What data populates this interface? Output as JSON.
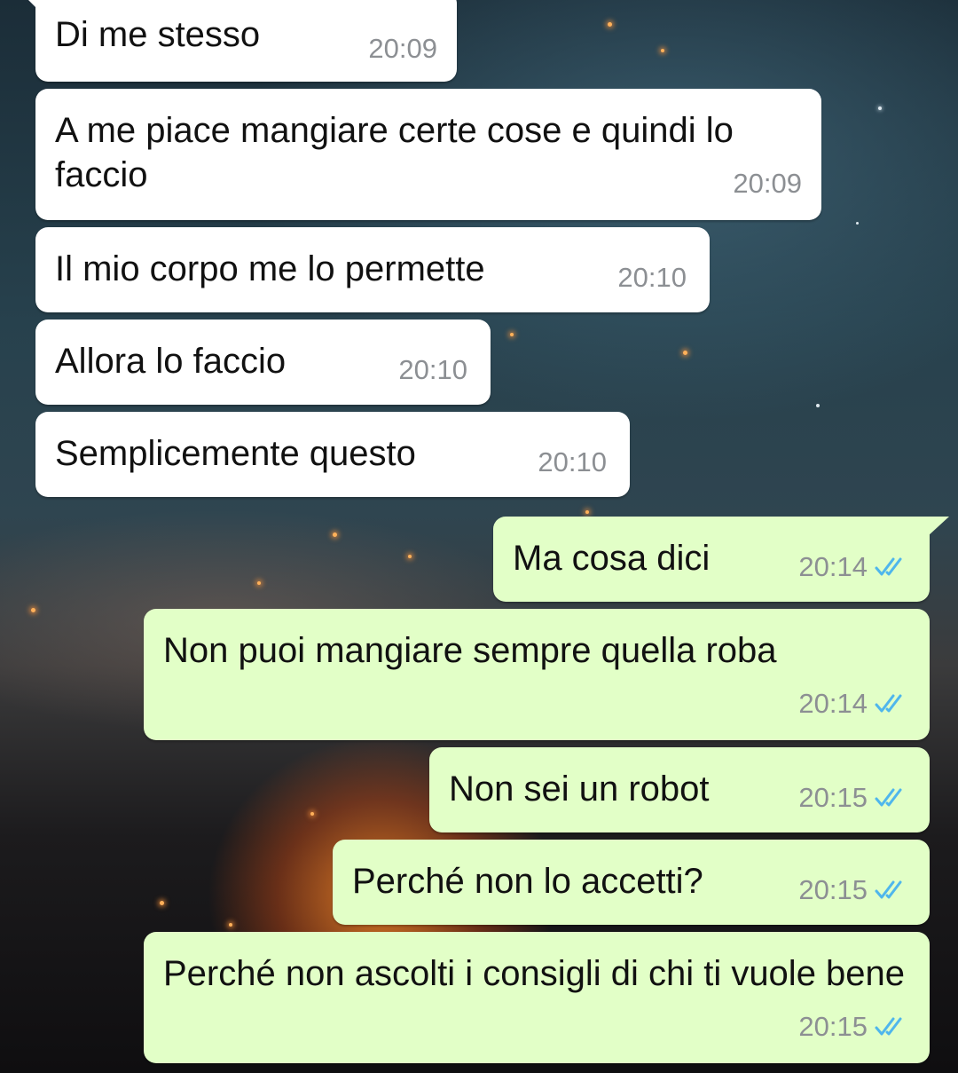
{
  "conversation": {
    "messages": [
      {
        "direction": "incoming",
        "text": "Di me stesso",
        "time": "20:09"
      },
      {
        "direction": "incoming",
        "text": "A me piace mangiare certe cose e quindi lo faccio",
        "time": "20:09"
      },
      {
        "direction": "incoming",
        "text": "Il mio corpo me lo permette",
        "time": "20:10"
      },
      {
        "direction": "incoming",
        "text": "Allora lo faccio",
        "time": "20:10"
      },
      {
        "direction": "incoming",
        "text": "Semplicemente questo",
        "time": "20:10"
      },
      {
        "direction": "outgoing",
        "text": "Ma cosa dici",
        "time": "20:14",
        "status": "read"
      },
      {
        "direction": "outgoing",
        "text": "Non puoi mangiare sempre quella roba",
        "time": "20:14",
        "status": "read"
      },
      {
        "direction": "outgoing",
        "text": "Non sei un robot",
        "time": "20:15",
        "status": "read"
      },
      {
        "direction": "outgoing",
        "text": "Perché non lo accetti?",
        "time": "20:15",
        "status": "read"
      },
      {
        "direction": "outgoing",
        "text": "Perché non ascolti i consigli di chi ti vuole bene",
        "time": "20:15",
        "status": "read"
      }
    ]
  },
  "colors": {
    "incoming_bubble": "#ffffff",
    "outgoing_bubble": "#e2ffc7",
    "timestamp": "#8c8f93",
    "read_receipt": "#4fb6ec"
  },
  "icons": {
    "read_receipt": "double-check-icon"
  }
}
